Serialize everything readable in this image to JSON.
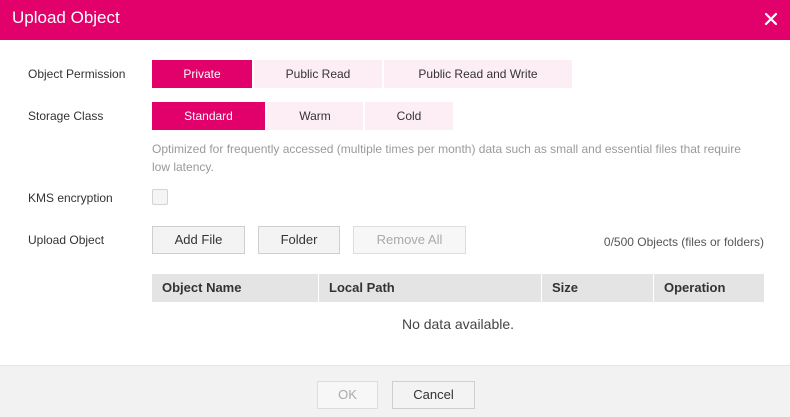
{
  "dialog": {
    "title": "Upload Object",
    "close_icon": "close-icon"
  },
  "permission": {
    "label": "Object Permission",
    "options": [
      "Private",
      "Public Read",
      "Public Read and Write"
    ],
    "selected": "Private"
  },
  "storage": {
    "label": "Storage Class",
    "options": [
      "Standard",
      "Warm",
      "Cold"
    ],
    "selected": "Standard",
    "hint": "Optimized for frequently accessed (multiple times per month) data such as small and essential files that require low latency."
  },
  "kms": {
    "label": "KMS encryption",
    "checked": false
  },
  "upload": {
    "label": "Upload Object",
    "add_file": "Add File",
    "folder": "Folder",
    "remove_all": "Remove All",
    "count_text": "0/500 Objects (files or folders)"
  },
  "table": {
    "columns": [
      "Object Name",
      "Local Path",
      "Size",
      "Operation"
    ],
    "empty_text": "No data available."
  },
  "footer": {
    "ok": "OK",
    "cancel": "Cancel"
  },
  "colors": {
    "accent": "#e2006a",
    "accent_light": "#fdeef5"
  }
}
